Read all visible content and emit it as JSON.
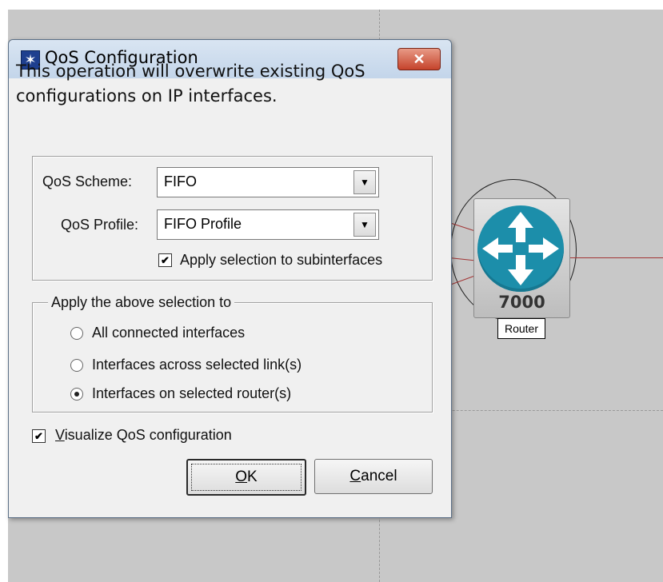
{
  "dialog": {
    "title": "QoS Configuration",
    "close_symbol": "✕",
    "message": "This operation will overwrite existing QoS configurations on IP interfaces.",
    "qos_scheme": {
      "label": "QoS Scheme:",
      "value": "FIFO"
    },
    "qos_profile": {
      "label": "QoS Profile:",
      "value": "FIFO Profile"
    },
    "apply_subinterfaces": {
      "label": "Apply selection to subinterfaces",
      "checked": true
    },
    "apply_group": {
      "title": "Apply the above selection to",
      "options": [
        {
          "label": "All connected interfaces",
          "selected": false
        },
        {
          "label": "Interfaces across selected link(s)",
          "selected": false
        },
        {
          "label": "Interfaces on selected router(s)",
          "selected": true
        }
      ]
    },
    "visualize": {
      "label_prefix": "V",
      "label_rest": "isualize QoS configuration",
      "checked": true
    },
    "ok_button": {
      "accel": "O",
      "rest": "K"
    },
    "cancel_button": {
      "accel": "C",
      "rest": "ancel"
    }
  },
  "router": {
    "model": "7000",
    "label": "Router"
  },
  "colors": {
    "router_blue": "#1c8eaa",
    "link_red": "#a23535",
    "canvas_gray": "#c8c8c8"
  },
  "icons": {
    "title_icon": "starburst-icon",
    "checkmark": "✔",
    "dropdown_arrow": "▼"
  }
}
